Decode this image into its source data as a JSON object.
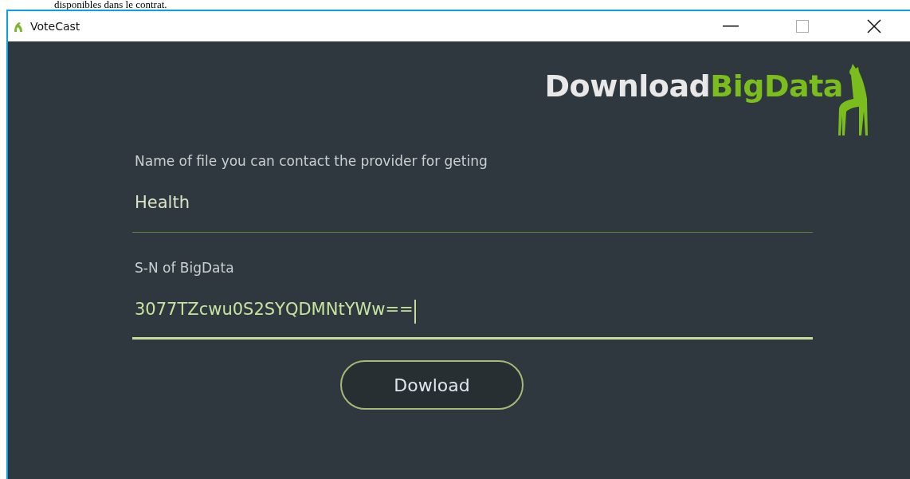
{
  "background_text": "disponibles dans le contrat.",
  "window": {
    "title": "VoteCast"
  },
  "logo": {
    "text": "Download",
    "accent": "BigData"
  },
  "fields": [
    {
      "label": "Name of file you can contact the provider for geting",
      "value": "Health",
      "focused": false
    },
    {
      "label": "S-N of BigData",
      "value": "3077TZcwu0S2SYQDMNtYWw==",
      "focused": true
    }
  ],
  "buttons": [
    "Dowload"
  ]
}
